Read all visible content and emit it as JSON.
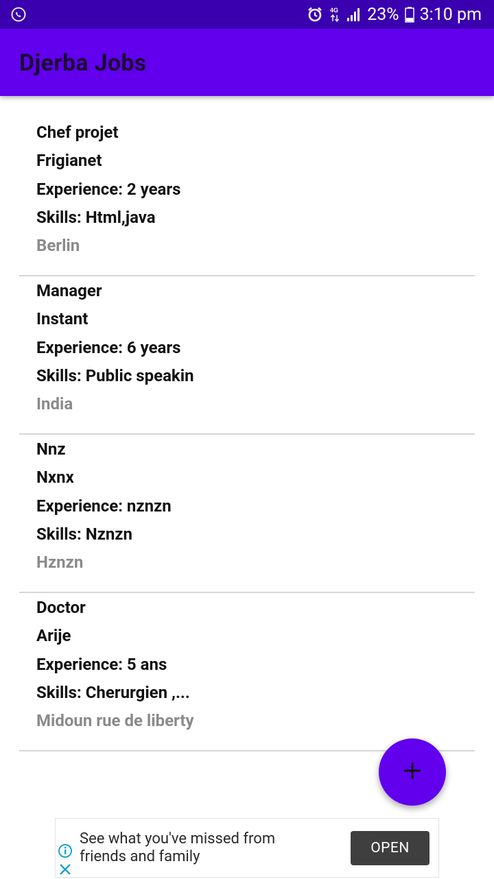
{
  "status_bar": {
    "battery": "23%",
    "time": "3:10 pm",
    "icons": [
      "call-icon",
      "alarm-icon",
      "4g-data-icon",
      "signal-icon",
      "battery-icon"
    ]
  },
  "app_bar": {
    "title": "Djerba Jobs"
  },
  "jobs": [
    {
      "title": "Chef projet",
      "company": "Frigianet",
      "experience": "Experience: 2 years",
      "skills": "Skills: Html,java",
      "location": "Berlin"
    },
    {
      "title": "Manager",
      "company": "Instant",
      "experience": "Experience: 6 years",
      "skills": "Skills: Public speakin",
      "location": "India"
    },
    {
      "title": "Nnz",
      "company": "Nxnx",
      "experience": "Experience: nznzn",
      "skills": "Skills: Nznzn",
      "location": "Hznzn"
    },
    {
      "title": "Doctor",
      "company": "Arije",
      "experience": "Experience: 5 ans",
      "skills": "Skills: Cherurgien ,...",
      "location": "Midoun rue de liberty"
    }
  ],
  "fab": {
    "icon": "plus-icon"
  },
  "ad": {
    "line1": "See what you've missed from",
    "line2": "friends and family",
    "button": "OPEN",
    "icons": [
      "info-icon",
      "close-icon"
    ]
  },
  "colors": {
    "status_bar": "#3a00b0",
    "app_bar": "#6200ee",
    "fab": "#6200ee",
    "location_text": "#8a8a8a",
    "ad_button": "#3f3f3f",
    "ad_icons": "#1aa3c9"
  }
}
